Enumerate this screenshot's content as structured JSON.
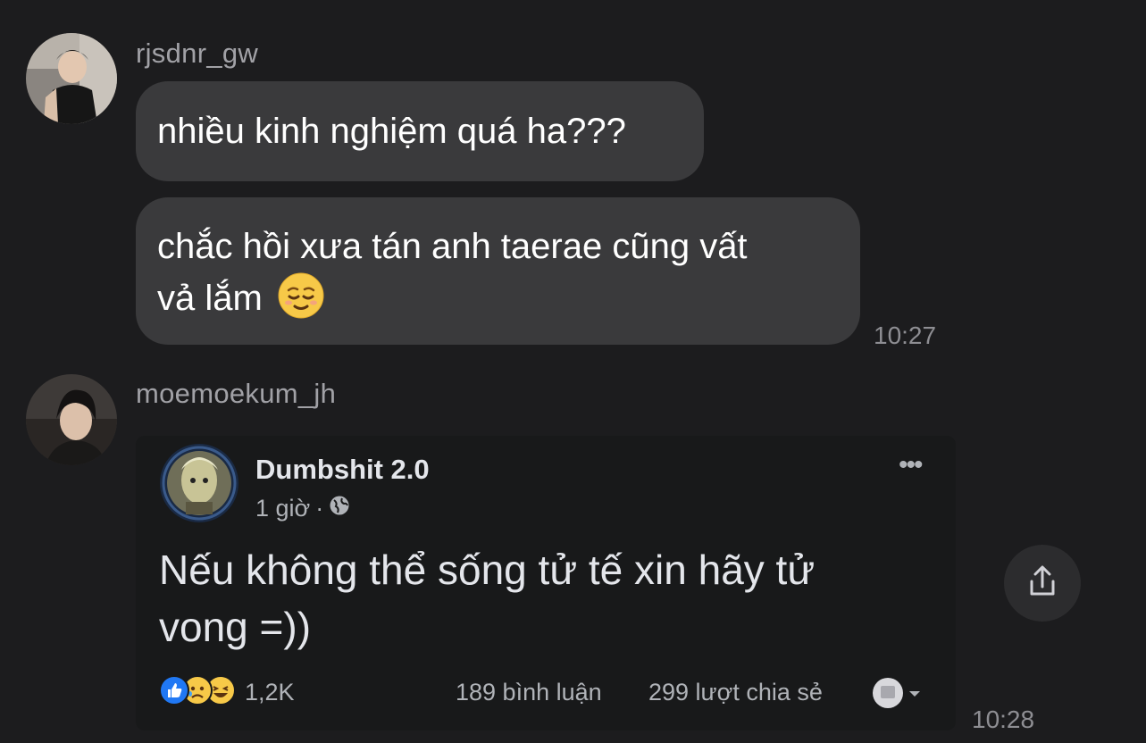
{
  "colors": {
    "background": "#1c1c1e",
    "bubble": "#3a3a3c",
    "username": "#a1a1a6",
    "timestamp": "#8e8e93"
  },
  "messages": [
    {
      "sender": "rjsdnr_gw",
      "bubbles": [
        {
          "text": "nhiều kinh nghiệm quá ha???"
        },
        {
          "text_line1": "chắc hồi xưa tán anh taerae cũng vất",
          "text_line2": "vả lắm",
          "emoji": "relieved-face-emoji"
        }
      ],
      "time": "10:27"
    },
    {
      "sender": "moemoekum_jh",
      "shared_post": {
        "page_name": "Dumbshit 2.0",
        "posted": "1 giờ",
        "audience_icon": "globe-icon",
        "text": "Nếu không thể sống tử tế xin hãy tử vong =))",
        "reaction_icons": [
          "like-icon",
          "sad-icon",
          "haha-icon"
        ],
        "reaction_count": "1,2K",
        "comments": "189 bình luận",
        "shares": "299 lượt chia sẻ"
      },
      "time": "10:28"
    }
  ],
  "actions": {
    "share_icon": "share-icon"
  }
}
